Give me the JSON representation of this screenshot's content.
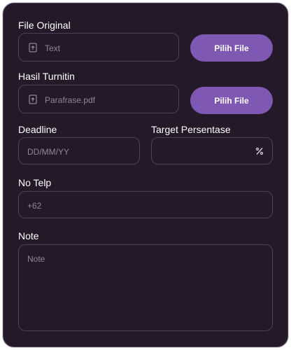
{
  "form": {
    "file_original": {
      "label": "File Original",
      "placeholder": "Text",
      "button": "Pilih File",
      "icon": "upload-file-icon"
    },
    "hasil_turnitin": {
      "label": "Hasil Turnitin",
      "value": "Parafrase.pdf",
      "button": "Pilih File",
      "icon": "upload-file-icon"
    },
    "deadline": {
      "label": "Deadline",
      "placeholder": "DD/MM/YY"
    },
    "target_persentase": {
      "label": "Target Persentase",
      "icon": "percent-icon"
    },
    "no_telp": {
      "label": "No Telp",
      "placeholder": "+62"
    },
    "note": {
      "label": "Note",
      "placeholder": "Note"
    }
  },
  "colors": {
    "card_bg": "#231928",
    "accent": "#7e58b3",
    "border": "#4d4058",
    "placeholder_text": "#8f8799",
    "label_text": "#ffffff"
  }
}
